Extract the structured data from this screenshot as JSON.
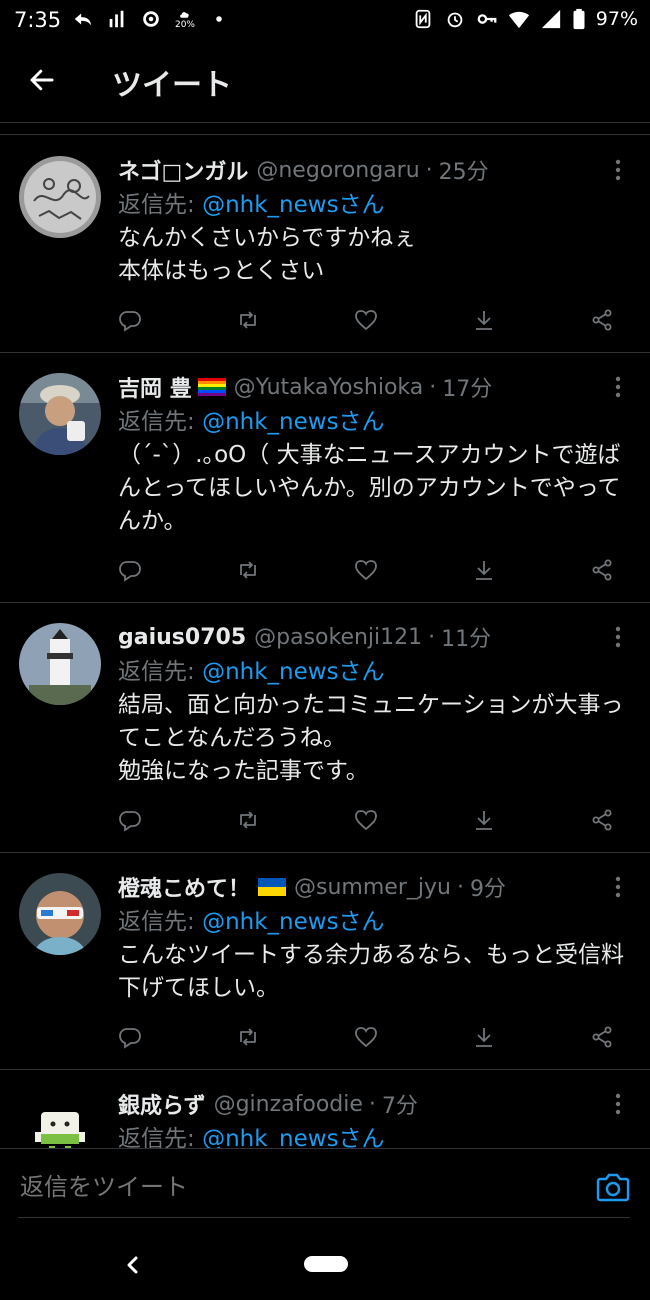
{
  "status_bar": {
    "time": "7:35",
    "battery": "97%",
    "data_saver_label": "20%",
    "left_icons": [
      "reply-arrow-icon",
      "signal-bars-icon",
      "sync-icon",
      "cloud-icon",
      "dot-icon"
    ],
    "right_icons": [
      "nfc-icon",
      "alarm-icon",
      "key-icon",
      "wifi-icon",
      "cell-signal-icon",
      "battery-icon"
    ]
  },
  "header": {
    "title": "ツイート",
    "back_icon": "arrow-left-icon"
  },
  "tweets": [
    {
      "name": "ネゴ□ンガル",
      "handle": "@negorongaru",
      "time": "25分",
      "reply_label": "返信先:",
      "reply_to": "@nhk_newsさん",
      "text": "なんかくさいからですかねぇ\n本体はもっとくさい",
      "avatar": "doodle-avatar"
    },
    {
      "name": "吉岡 豊",
      "handle": "@YutakaYoshioka",
      "time": "17分",
      "reply_label": "返信先:",
      "reply_to": "@nhk_newsさん",
      "text": "（´-`）.｡oO（ 大事なニュースアカウントで遊ばんとってほしいやんか。別のアカウントでやってんか。",
      "avatar": "man-with-cap-avatar",
      "name_flag": "rainbow-flag"
    },
    {
      "name": "gaius0705",
      "handle": "@pasokenji121",
      "time": "11分",
      "reply_label": "返信先:",
      "reply_to": "@nhk_newsさん",
      "text": "結局、面と向かったコミュニケーションが大事ってことなんだろうね。\n勉強になった記事です。",
      "avatar": "lighthouse-avatar"
    },
    {
      "name": "橙魂こめて！",
      "handle": "@summer_jyu",
      "time": "9分",
      "reply_label": "返信先:",
      "reply_to": "@nhk_newsさん",
      "text": "こんなツイートする余力あるなら、もっと受信料下げてほしい。",
      "avatar": "man-with-glasses-avatar",
      "name_flag": "ukraine-flag"
    },
    {
      "name": "銀成らず",
      "handle": "@ginzafoodie",
      "time": "7分",
      "reply_label": "返信先:",
      "reply_to": "@nhk_newsさん",
      "text": "",
      "avatar": "robot-avatar"
    }
  ],
  "action_icons": [
    "reply-icon",
    "retweet-icon",
    "like-icon",
    "download-icon",
    "share-icon"
  ],
  "compose": {
    "placeholder": "返信をツイート",
    "camera_icon": "camera-icon"
  },
  "nav_bar": {
    "back_icon": "chevron-left-icon",
    "home_icon": "home-pill-icon"
  },
  "colors": {
    "background": "#000000",
    "text": "#e7e9ea",
    "muted": "#71767b",
    "link": "#1d9bf0",
    "divider": "#2f3336"
  }
}
